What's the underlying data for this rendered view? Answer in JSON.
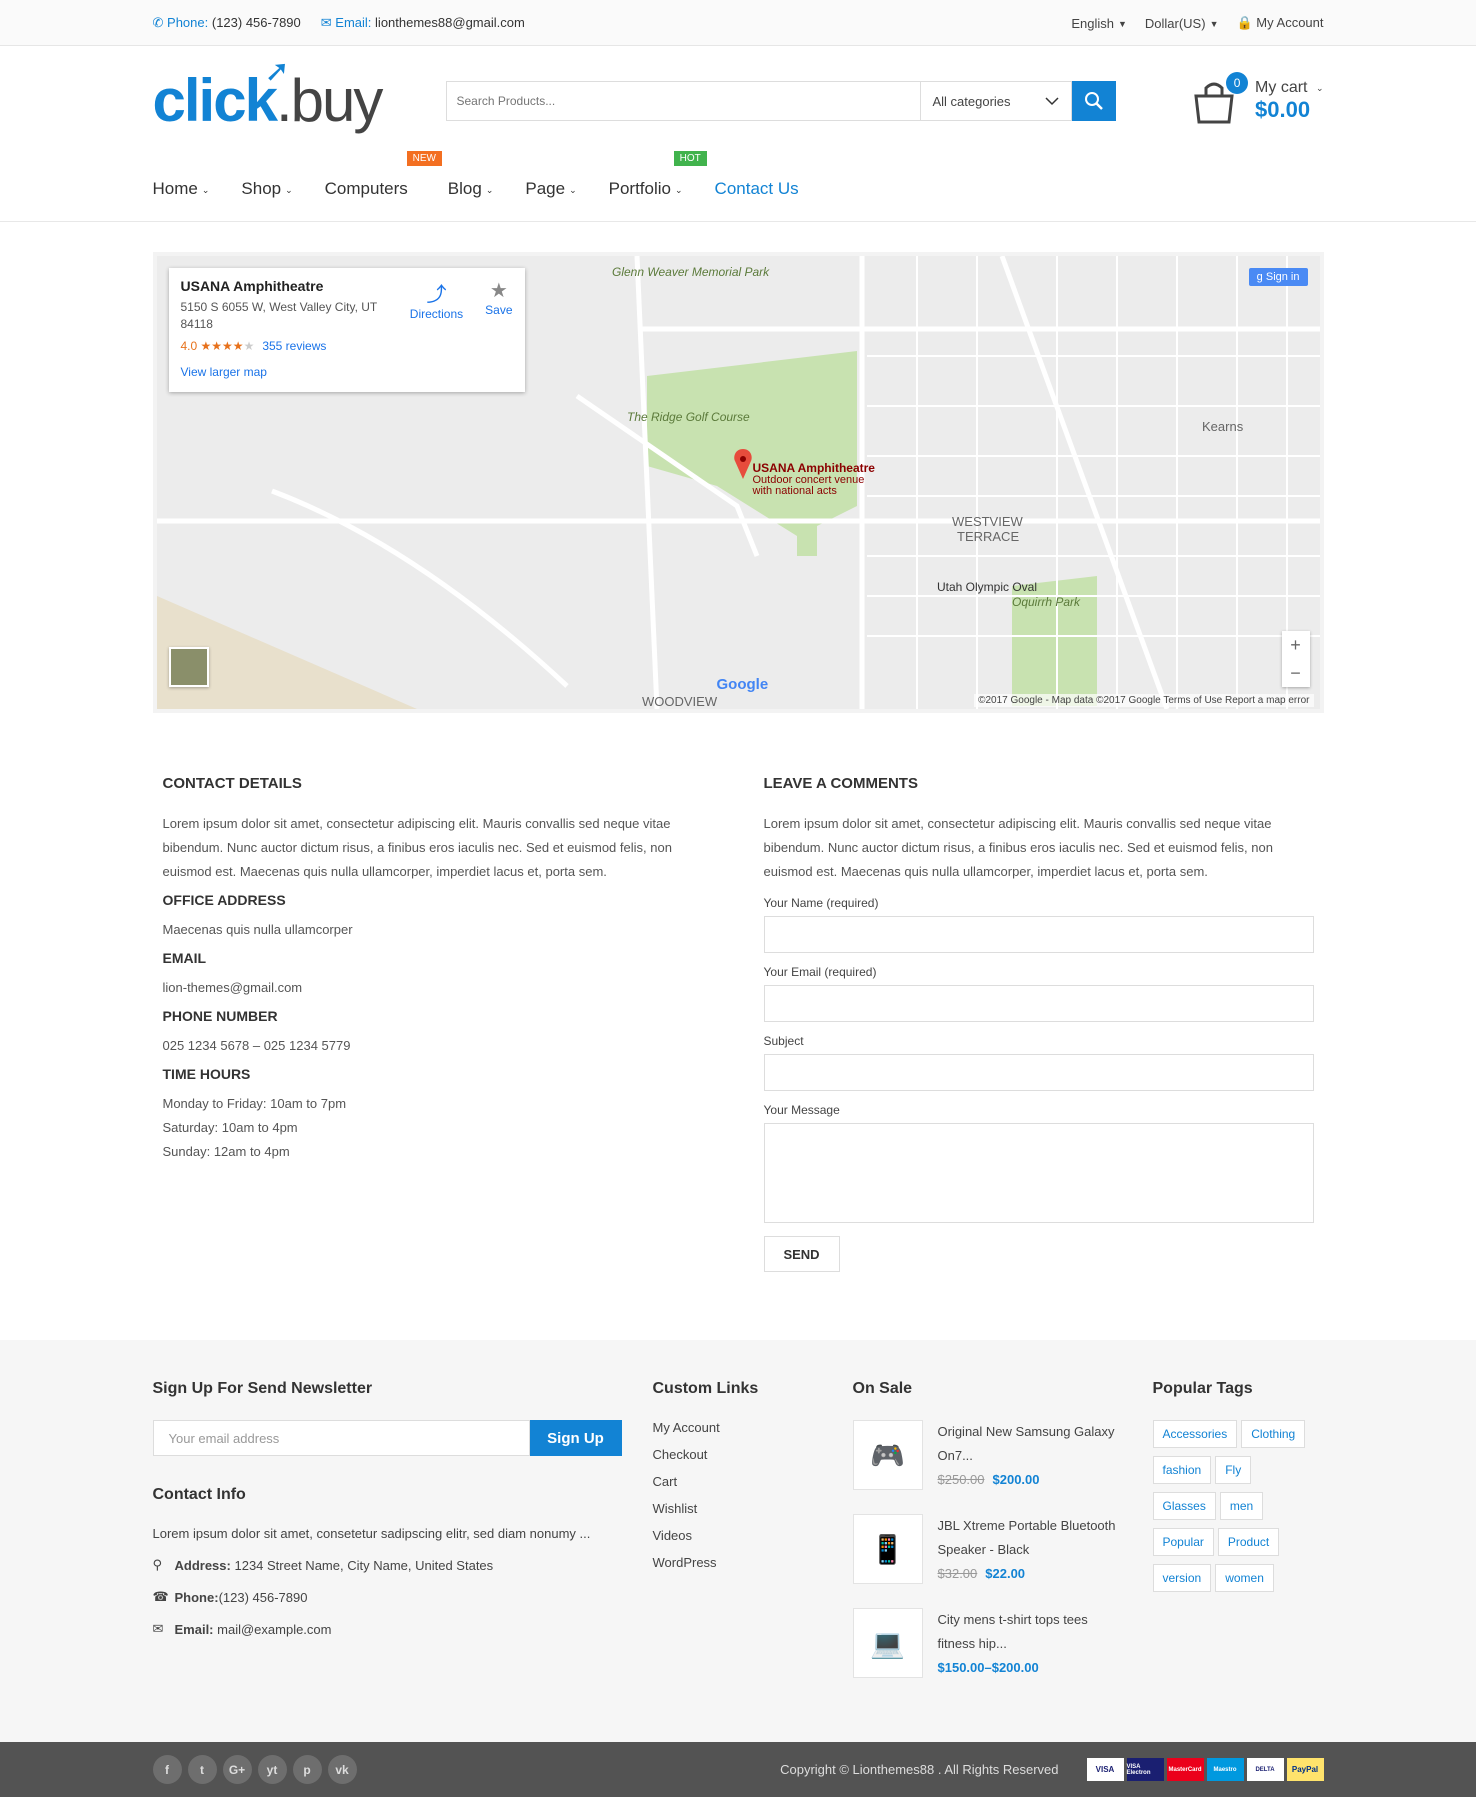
{
  "topbar": {
    "phone_label": "Phone:",
    "phone_value": "(123) 456-7890",
    "email_label": "Email:",
    "email_value": "lionthemes88@gmail.com",
    "language": "English",
    "currency": "Dollar(US)",
    "account": "My Account"
  },
  "header": {
    "logo_part1": "click",
    "logo_part2": ".buy",
    "search_placeholder": "Search Products...",
    "category": "All categories",
    "cart_count": "0",
    "cart_label": "My cart",
    "cart_total": "$0.00"
  },
  "nav": {
    "items": [
      {
        "label": "Home"
      },
      {
        "label": "Shop"
      },
      {
        "label": "Computers",
        "badge": "NEW"
      },
      {
        "label": "Blog"
      },
      {
        "label": "Page"
      },
      {
        "label": "Portfolio",
        "badge": "HOT"
      },
      {
        "label": "Contact Us"
      }
    ]
  },
  "map": {
    "place_name": "USANA Amphitheatre",
    "address": "5150 S 6055 W, West Valley City, UT 84118",
    "rating": "4.0",
    "stars": "★★★★",
    "reviews": "355 reviews",
    "larger_map": "View larger map",
    "directions": "Directions",
    "save": "Save",
    "sign_in": "Sign in",
    "pin_title": "USANA Amphitheatre",
    "pin_sub1": "Outdoor concert venue",
    "pin_sub2": "with national acts",
    "attribution": "©2017 Google - Map data ©2017 Google   Terms of Use   Report a map error",
    "google": "Google",
    "labels": [
      "Glenn Weaver Memorial Park",
      "The Ridge Golf Course",
      "Kearns",
      "WESTVIEW TERRACE",
      "Utah Olympic Oval",
      "Oquirrh Park",
      "WOODVIEW ESTATES"
    ]
  },
  "contact": {
    "details_title": "CONTACT DETAILS",
    "details_text": "Lorem ipsum dolor sit amet, consectetur adipiscing elit. Mauris convallis sed neque vitae bibendum. Nunc auctor dictum risus, a finibus eros iaculis nec. Sed et euismod felis, non euismod est. Maecenas quis nulla ullamcorper, imperdiet lacus et, porta sem.",
    "office_title": "OFFICE ADDRESS",
    "office_value": "Maecenas quis nulla ullamcorper",
    "email_title": "EMAIL",
    "email_value": "lion-themes@gmail.com",
    "phone_title": "PHONE NUMBER",
    "phone_value": "025 1234 5678 – 025 1234 5779",
    "hours_title": "TIME HOURS",
    "hours": [
      "Monday to Friday: 10am to 7pm",
      "Saturday: 10am to 4pm",
      "Sunday: 12am to 4pm"
    ],
    "form_title": "LEAVE A COMMENTS",
    "form_text": "Lorem ipsum dolor sit amet, consectetur adipiscing elit. Mauris convallis sed neque vitae bibendum. Nunc auctor dictum risus, a finibus eros iaculis nec. Sed et euismod felis, non euismod est. Maecenas quis nulla ullamcorper, imperdiet lacus et, porta sem.",
    "name_label": "Your Name (required)",
    "email_label": "Your Email (required)",
    "subject_label": "Subject",
    "message_label": "Your Message",
    "send": "SEND"
  },
  "footer": {
    "newsletter_title": "Sign Up For Send Newsletter",
    "newsletter_placeholder": "Your email address",
    "newsletter_button": "Sign Up",
    "contact_title": "Contact Info",
    "contact_text": "Lorem ipsum dolor sit amet, consetetur sadipscing elitr, sed diam nonumy ...",
    "address_label": "Address:",
    "address_value": "1234 Street Name, City Name, United States",
    "phone_label": "Phone:",
    "phone_value": "(123) 456-7890",
    "email_label": "Email:",
    "email_value": "mail@example.com",
    "links_title": "Custom Links",
    "links": [
      "My Account",
      "Checkout",
      "Cart",
      "Wishlist",
      "Videos",
      "WordPress"
    ],
    "sale_title": "On Sale",
    "products": [
      {
        "name": "Original New Samsung Galaxy On7...",
        "old": "$250.00",
        "price": "$200.00"
      },
      {
        "name": "JBL Xtreme Portable Bluetooth Speaker - Black",
        "old": "$32.00",
        "price": "$22.00"
      },
      {
        "name": "City mens t-shirt tops tees fitness hip...",
        "old": "",
        "price": "$150.00–$200.00"
      }
    ],
    "tags_title": "Popular Tags",
    "tags": [
      "Accessories",
      "Clothing",
      "fashion",
      "Fly",
      "Glasses",
      "men",
      "Popular",
      "Product",
      "version",
      "women"
    ],
    "copyright": "Copyright © Lionthemes88 . All Rights Reserved",
    "socials": [
      "f",
      "t",
      "G+",
      "yt",
      "p",
      "vk"
    ],
    "payments": [
      "VISA",
      "VISA Electron",
      "MasterCard",
      "Maestro",
      "DELTA",
      "PayPal"
    ]
  }
}
